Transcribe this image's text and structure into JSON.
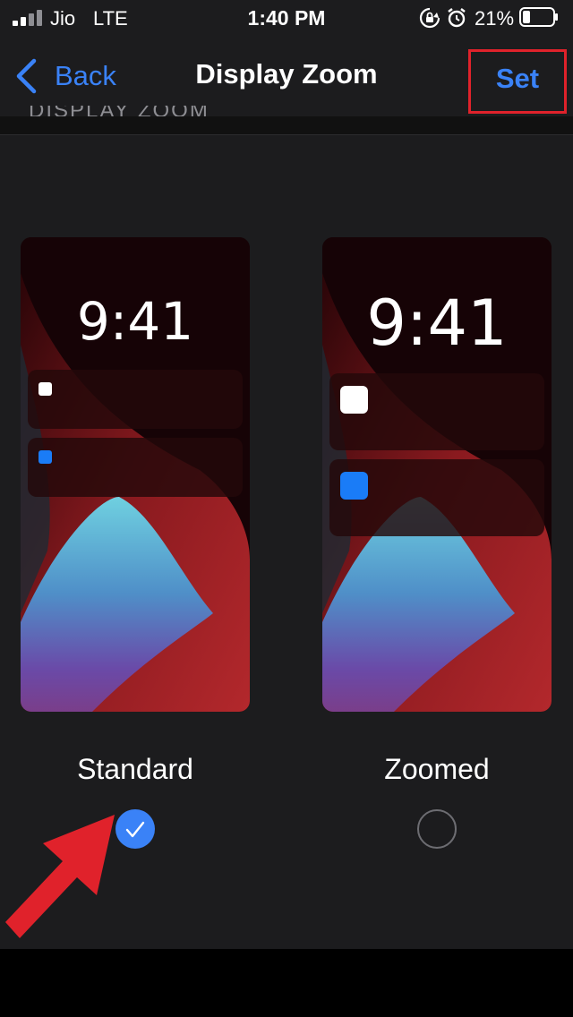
{
  "status_bar": {
    "carrier": "Jio",
    "network": "LTE",
    "time": "1:40 PM",
    "battery_percent": "21%",
    "icons": [
      "signal-icon",
      "orientation-lock-icon",
      "alarm-icon",
      "battery-icon"
    ]
  },
  "nav": {
    "back_label": "Back",
    "title": "Display Zoom",
    "set_label": "Set",
    "section_header_fragment": "DISPLAY ZOOM"
  },
  "options": [
    {
      "label": "Standard",
      "preview_time": "9:41",
      "selected": true
    },
    {
      "label": "Zoomed",
      "preview_time": "9:41",
      "selected": false
    }
  ],
  "colors": {
    "accent": "#3a82f7",
    "highlight_box": "#e0222b",
    "annotation_arrow": "#e0222b"
  }
}
